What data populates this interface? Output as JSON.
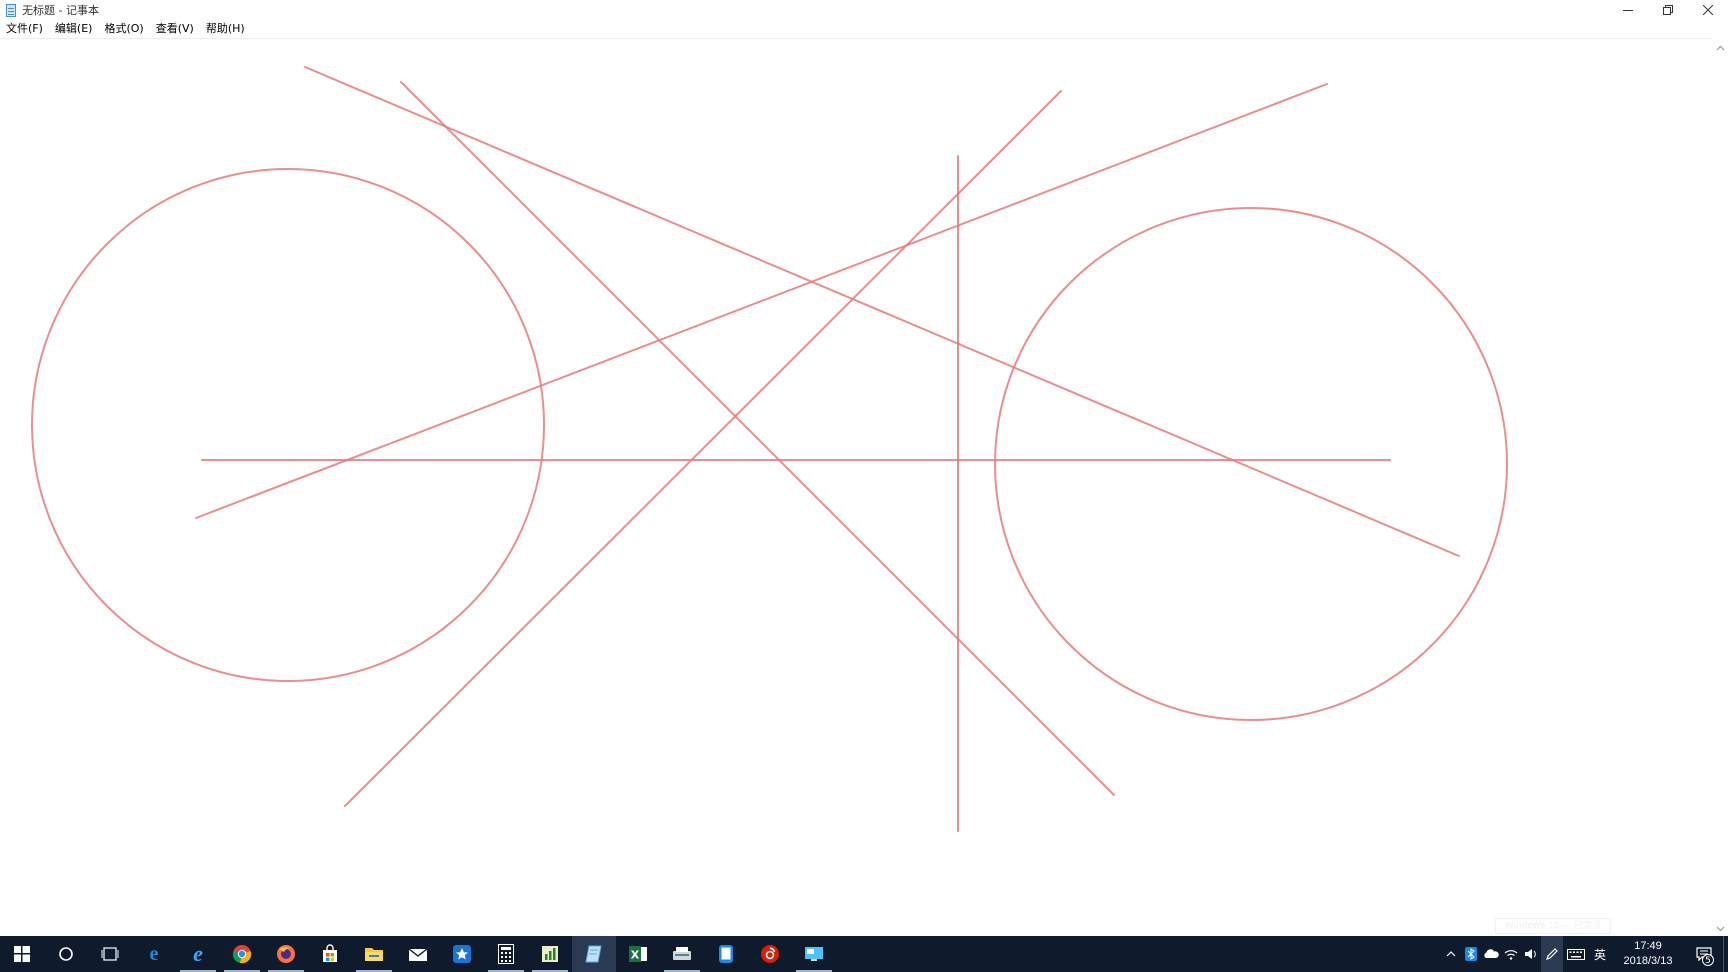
{
  "window": {
    "title": "无标题 - 记事本"
  },
  "menu": [
    {
      "label": "文件(F)"
    },
    {
      "label": "编辑(E)"
    },
    {
      "label": "格式(O)"
    },
    {
      "label": "查看(V)"
    },
    {
      "label": "帮助(H)"
    }
  ],
  "editor": {
    "content": "",
    "watermark": "Windows 10 — 已激活"
  },
  "drawing": {
    "stroke_color": "#e87a7a",
    "stroke_width": 2,
    "lines": [
      [
        305,
        66,
        1459,
        555
      ],
      [
        401,
        81,
        1114,
        794
      ],
      [
        1061,
        90,
        345,
        805
      ],
      [
        1327,
        83,
        196,
        517
      ],
      [
        958,
        155,
        958,
        830
      ],
      [
        202,
        459,
        1390,
        459
      ]
    ],
    "circles": [
      [
        288,
        424,
        256
      ],
      [
        1251,
        463,
        256
      ]
    ]
  },
  "taskbar": {
    "background": "#0f1b2d",
    "apps": [
      {
        "name": "start",
        "icon": "windows-logo-icon"
      },
      {
        "name": "cortana",
        "icon": "search-ring-icon"
      },
      {
        "name": "task-view",
        "icon": "task-view-icon"
      },
      {
        "name": "edge",
        "icon": "edge-icon",
        "glyph": "e",
        "color": "#1e88e5"
      },
      {
        "name": "internet-explorer",
        "icon": "ie-icon",
        "glyph": "e",
        "color": "#3fa9f5",
        "running": true
      },
      {
        "name": "chrome",
        "icon": "chrome-icon",
        "running": true
      },
      {
        "name": "firefox",
        "icon": "firefox-icon",
        "running": true
      },
      {
        "name": "store",
        "icon": "store-icon"
      },
      {
        "name": "file-explorer",
        "icon": "folder-icon",
        "running": true
      },
      {
        "name": "mail",
        "icon": "mail-icon"
      },
      {
        "name": "favorites",
        "icon": "star-app-icon"
      },
      {
        "name": "calculator",
        "icon": "calculator-icon",
        "running": true
      },
      {
        "name": "charts-app",
        "icon": "chart-app-icon",
        "running": true
      },
      {
        "name": "notepad",
        "icon": "notepad-icon",
        "active": true
      },
      {
        "name": "excel",
        "icon": "excel-icon",
        "glyph": "X",
        "color": "#1d6f42"
      },
      {
        "name": "scanner",
        "icon": "scanner-icon",
        "running": true
      },
      {
        "name": "phone-app",
        "icon": "phone-icon"
      },
      {
        "name": "netease-music",
        "icon": "music-icon",
        "glyph": "◉",
        "color": "#d81e06"
      },
      {
        "name": "remote-desktop",
        "icon": "remote-desktop-icon",
        "running": true
      }
    ],
    "tray": {
      "ime": "英",
      "time": "17:49",
      "date": "2018/3/13",
      "notifications": "5"
    }
  }
}
